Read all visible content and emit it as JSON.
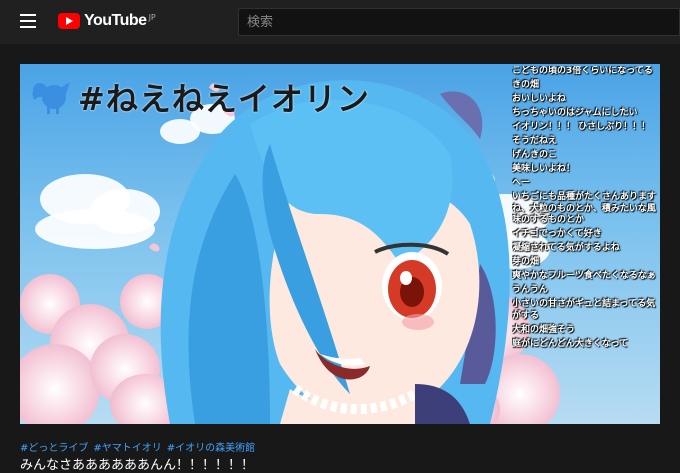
{
  "header": {
    "logo_text": "YouTube",
    "logo_region": "JP",
    "search_placeholder": "検索"
  },
  "video": {
    "overlay_title": "#ねえねえイオリン",
    "chat": [
      "こどもの頃の3倍くらいになってる",
      "きの畑",
      "おいしいよね",
      "ちっちゃいのはジャムにしたい",
      "イオリン！！！ ひさしぶり！！！",
      "そうだねえ",
      "げんきのこ",
      "美味しいよね！",
      "へー",
      "いちごにも品種がたくさんありますね、大粒のものとか、積みたいな風味のするものとか",
      "イチゴでっかくて好き",
      "凝縮されてる気がするよね",
      "芽の畑",
      "爽やかなフルーツ食べたくなるなぁ",
      "うんうん",
      "小さいの甘さがギュと詰まってる気がする",
      "大和の畑強そう",
      "庭がにどんどん大きくなって"
    ]
  },
  "meta": {
    "tags": [
      "#どっとライブ",
      "#ヤマトイオリ",
      "#イオリの森美術館"
    ],
    "title": "みんなさああああああんん！！！！！！"
  },
  "colors": {
    "header_bg": "#202020",
    "page_bg": "#181818",
    "brand_red": "#ff0000",
    "tag_blue": "#3ea6ff",
    "overlay_bird_blue": "#3a8fe0"
  }
}
